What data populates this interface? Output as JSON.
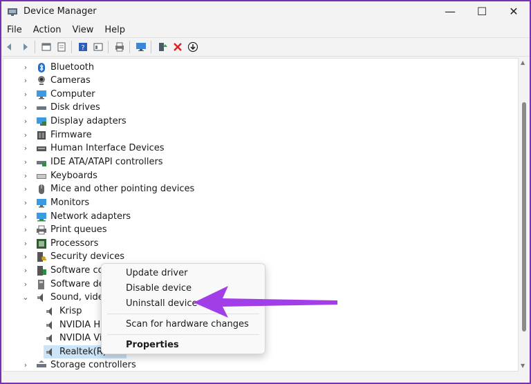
{
  "window": {
    "title": "Device Manager"
  },
  "title_controls": {
    "minimize": "—",
    "maximize": "☐",
    "close": "✕"
  },
  "menu": [
    "File",
    "Action",
    "View",
    "Help"
  ],
  "toolbar_icons": [
    "back-icon",
    "forward-icon",
    "properties-icon",
    "update-icon",
    "help-icon",
    "show-hidden-icon",
    "print-icon",
    "monitor-icon",
    "enable-driver-icon",
    "uninstall-icon",
    "download-icon"
  ],
  "tree": {
    "categories": [
      {
        "label": "Bluetooth",
        "icon": "bluetooth-icon",
        "expanded": false
      },
      {
        "label": "Cameras",
        "icon": "camera-icon",
        "expanded": false
      },
      {
        "label": "Computer",
        "icon": "computer-icon",
        "expanded": false
      },
      {
        "label": "Disk drives",
        "icon": "disk-icon",
        "expanded": false
      },
      {
        "label": "Display adapters",
        "icon": "display-icon",
        "expanded": false
      },
      {
        "label": "Firmware",
        "icon": "firmware-icon",
        "expanded": false
      },
      {
        "label": "Human Interface Devices",
        "icon": "hid-icon",
        "expanded": false
      },
      {
        "label": "IDE ATA/ATAPI controllers",
        "icon": "ide-icon",
        "expanded": false
      },
      {
        "label": "Keyboards",
        "icon": "keyboard-icon",
        "expanded": false
      },
      {
        "label": "Mice and other pointing devices",
        "icon": "mouse-icon",
        "expanded": false
      },
      {
        "label": "Monitors",
        "icon": "monitor-icon",
        "expanded": false
      },
      {
        "label": "Network adapters",
        "icon": "network-icon",
        "expanded": false
      },
      {
        "label": "Print queues",
        "icon": "printer-icon",
        "expanded": false
      },
      {
        "label": "Processors",
        "icon": "processor-icon",
        "expanded": false
      },
      {
        "label": "Security devices",
        "icon": "security-icon",
        "expanded": false
      },
      {
        "label": "Software comp",
        "icon": "software-component-icon",
        "expanded": false
      },
      {
        "label": "Software device",
        "icon": "software-device-icon",
        "expanded": false
      },
      {
        "label": "Sound, video ar",
        "icon": "speaker-icon",
        "expanded": true
      },
      {
        "label": "Storage controllers",
        "icon": "storage-icon",
        "expanded": false
      }
    ],
    "sound_children": [
      {
        "label": "Krisp",
        "selected": false
      },
      {
        "label": "NVIDIA Hig",
        "selected": false
      },
      {
        "label": "NVIDIA Virt",
        "selected": false
      },
      {
        "label": "Realtek(R) A",
        "selected": true
      }
    ]
  },
  "context_menu": {
    "update_driver": "Update driver",
    "disable_device": "Disable device",
    "uninstall_device": "Uninstall device",
    "scan_hardware": "Scan for hardware changes",
    "properties": "Properties"
  },
  "colors": {
    "annotation_arrow": "#a23ee8",
    "selection": "#cce4f7",
    "frame": "#7a2fb0"
  }
}
